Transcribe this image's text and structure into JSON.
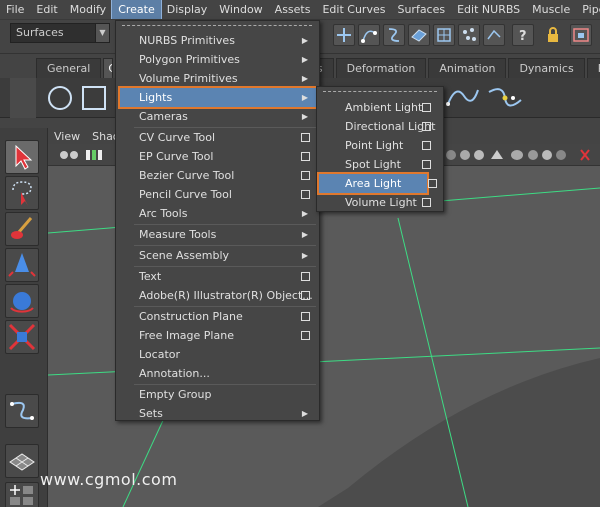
{
  "menubar": {
    "items": [
      "File",
      "Edit",
      "Modify",
      "Create",
      "Display",
      "Window",
      "Assets",
      "Edit Curves",
      "Surfaces",
      "Edit NURBS",
      "Muscle",
      "Pipeline C"
    ]
  },
  "statusline": {
    "menuset": "Surfaces"
  },
  "shelf": {
    "tabs": [
      "General",
      "C",
      "divs",
      "Deformation",
      "Animation",
      "Dynamics",
      "Ren"
    ]
  },
  "panel": {
    "menu": [
      "View",
      "Shad"
    ]
  },
  "create_menu": {
    "items": [
      {
        "label": "NURBS Primitives",
        "kind": "submenu"
      },
      {
        "label": "Polygon Primitives",
        "kind": "submenu"
      },
      {
        "label": "Volume Primitives",
        "kind": "submenu"
      },
      {
        "label": "Lights",
        "kind": "submenu"
      },
      {
        "label": "Cameras",
        "kind": "submenu"
      },
      {
        "label": "CV Curve Tool",
        "kind": "option"
      },
      {
        "label": "EP Curve Tool",
        "kind": "option"
      },
      {
        "label": "Bezier Curve Tool",
        "kind": "option"
      },
      {
        "label": "Pencil Curve Tool",
        "kind": "option"
      },
      {
        "label": "Arc Tools",
        "kind": "submenu"
      },
      {
        "label": "Measure Tools",
        "kind": "submenu"
      },
      {
        "label": "Scene Assembly",
        "kind": "submenu"
      },
      {
        "label": "Text",
        "kind": "option"
      },
      {
        "label": "Adobe(R) Illustrator(R) Object...",
        "kind": "option"
      },
      {
        "label": "Construction Plane",
        "kind": "option"
      },
      {
        "label": "Free Image Plane",
        "kind": "option"
      },
      {
        "label": "Locator",
        "kind": "plain"
      },
      {
        "label": "Annotation...",
        "kind": "plain"
      },
      {
        "label": "Empty Group",
        "kind": "plain"
      },
      {
        "label": "Sets",
        "kind": "submenu"
      }
    ]
  },
  "lights_menu": {
    "items": [
      "Ambient Light",
      "Directional Light",
      "Point Light",
      "Spot Light",
      "Area Light",
      "Volume Light"
    ]
  },
  "watermark": "www.cgmol.com",
  "colors": {
    "highlight": "#5b84b2",
    "highlight_outline": "#e0782d",
    "grid_line": "#3ddc84"
  }
}
